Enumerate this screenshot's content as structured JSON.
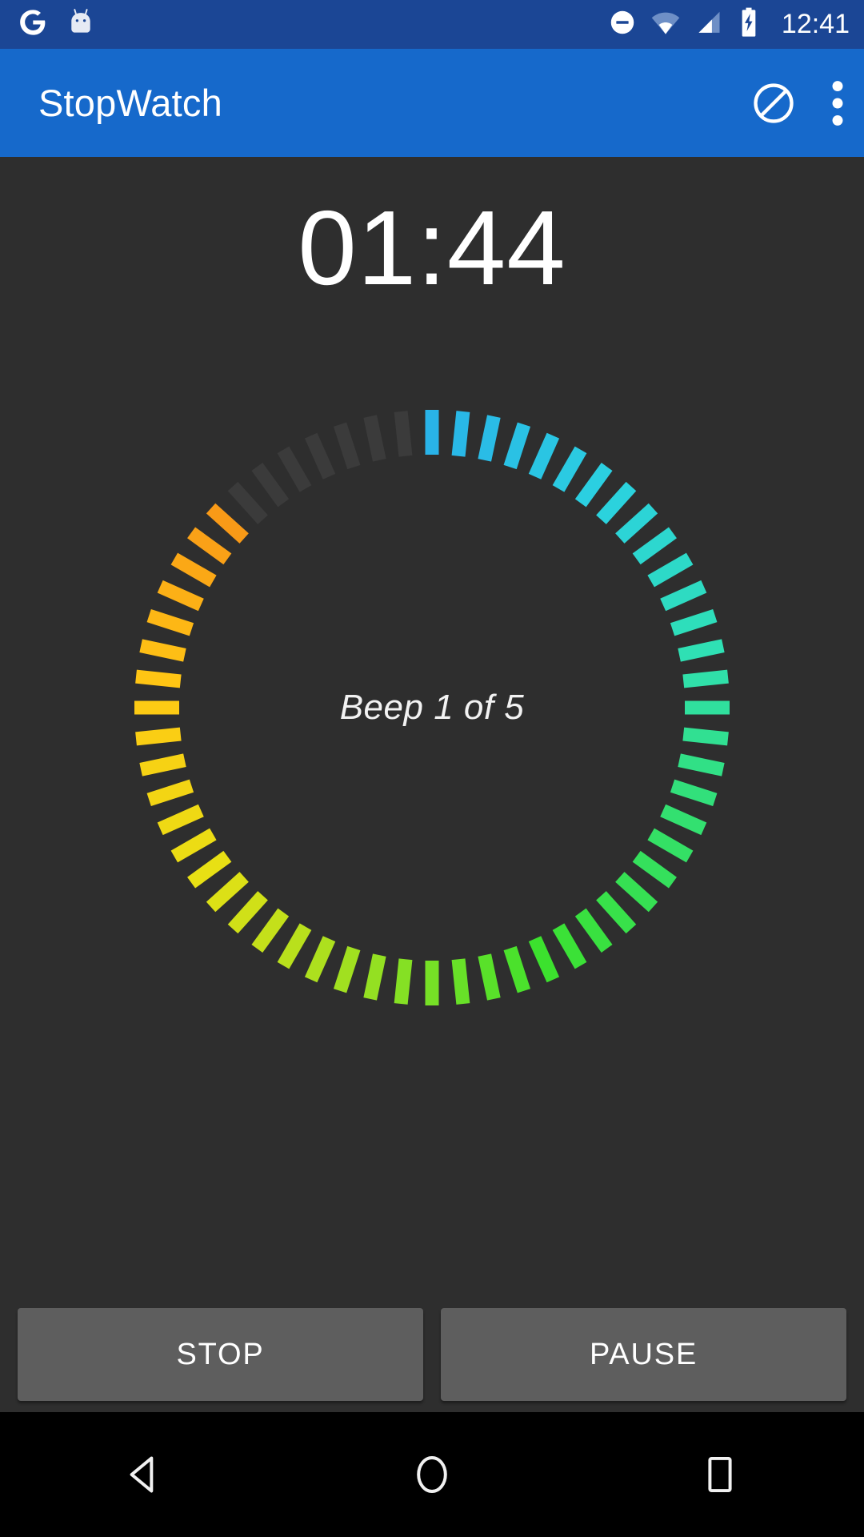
{
  "status_bar": {
    "background_color": "#1B4695",
    "clock": "12:41",
    "left_icons": [
      {
        "name": "google-logo-icon",
        "label": "G"
      },
      {
        "name": "android-robot-icon",
        "label": "Android"
      }
    ],
    "right_icons": [
      {
        "name": "do-not-disturb-icon",
        "label": "Do Not Disturb"
      },
      {
        "name": "wifi-icon",
        "label": "Wi-Fi"
      },
      {
        "name": "cellular-signal-icon",
        "label": "Signal"
      },
      {
        "name": "battery-charging-icon",
        "label": "Battery charging"
      }
    ]
  },
  "app_bar": {
    "background_color": "#1669CB",
    "title": "StopWatch",
    "actions": [
      {
        "name": "block-icon",
        "label": "Do not disturb / block"
      },
      {
        "name": "overflow-menu-icon",
        "label": "More options"
      }
    ]
  },
  "main": {
    "background_color": "#2E2E2E",
    "timer": "01:44",
    "beep_label": "Beep 1 of 5"
  },
  "gauge": {
    "total_ticks": 60,
    "active_ticks": 53,
    "inactive_ticks": 7,
    "start_angle_deg": -90,
    "inactive_color": "#3B3B3B",
    "gradient_stops": [
      "#29B3E8",
      "#2BD1E0",
      "#2FE0B4",
      "#33E06A",
      "#3CE12E",
      "#9BE021",
      "#E8E014",
      "#FFC914",
      "#F99A17"
    ],
    "outer_radius": 372,
    "tick_length": 56,
    "tick_width": 17
  },
  "buttons": [
    {
      "name": "stop-button",
      "label": "STOP"
    },
    {
      "name": "pause-button",
      "label": "PAUSE"
    }
  ],
  "nav_bar": {
    "background_color": "#000000",
    "items": [
      {
        "name": "back-nav-button",
        "label": "Back"
      },
      {
        "name": "home-nav-button",
        "label": "Home"
      },
      {
        "name": "recents-nav-button",
        "label": "Recent apps"
      }
    ]
  }
}
